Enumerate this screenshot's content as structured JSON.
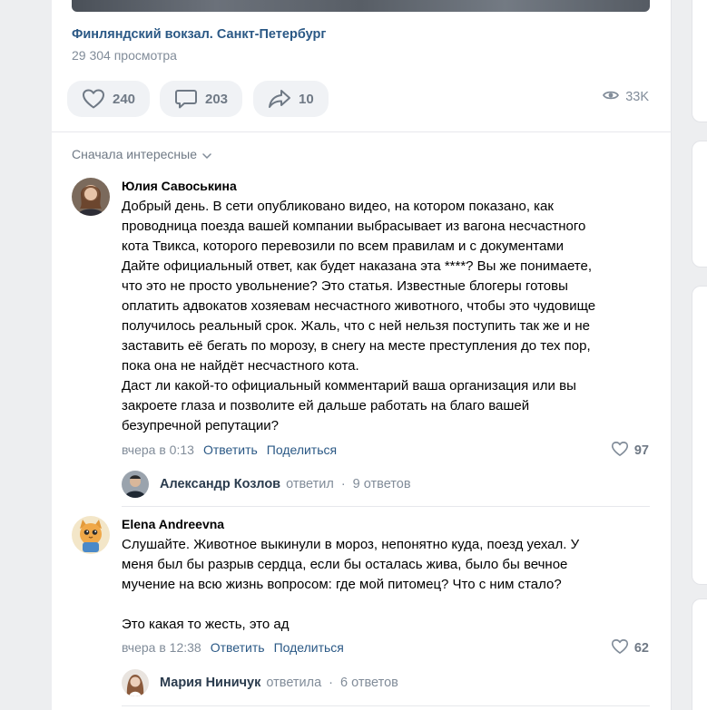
{
  "video": {
    "title": "Финляндский вокзал. Санкт-Петербург",
    "views": "29 304 просмотра"
  },
  "actions": {
    "likes": "240",
    "comments": "203",
    "shares": "10",
    "views_total": "33K"
  },
  "sort": {
    "label": "Сначала интересные"
  },
  "comments": [
    {
      "author": "Юлия Савоськина",
      "text": "Добрый день. В сети опубликовано видео, на котором показано, как\nпроводница поезда вашей компании выбрасывает из вагона несчастного\nкота Твикса, которого перевозили по всем правилам и с документами\nДайте официальный ответ, как будет наказана эта ****? Вы же понимаете,\nчто это не просто увольнение? Это статья. Известные блогеры готовы\nоплатить адвокатов хозяевам несчастного животного, чтобы это чудовище\nполучилось реальный срок. Жаль, что с ней нельзя поступить так же и не\nзаставить её бегать по морозу, в снегу на месте преступления до тех пор,\nпока она не найдёт несчастного кота.\nДаст ли какой-то официальный комментарий ваша организация или вы\nзакроете глаза и позволите ей дальше работать на благо вашей\nбезупречной репутации?",
      "time": "вчера в 0:13",
      "reply_label": "Ответить",
      "share_label": "Поделиться",
      "likes": "97",
      "reply_preview": {
        "name": "Александр Козлов",
        "verb": "ответил",
        "count": "9 ответов"
      }
    },
    {
      "author": "Elena Andreevna",
      "text": "Слушайте. Животное выкинули в мороз, непонятно куда, поезд уехал. У\nменя был бы разрыв сердца, если бы осталась жива, было бы вечное\nмучение на всю жизнь вопросом: где мой питомец? Что с ним стало?\n\nЭто какая то жесть, это ад",
      "time": "вчера в 12:38",
      "reply_label": "Ответить",
      "share_label": "Поделиться",
      "likes": "62",
      "reply_preview": {
        "name": "Мария Ниничук",
        "verb": "ответила",
        "count": "6 ответов"
      }
    }
  ],
  "colors": {
    "link": "#2a5885",
    "secondary": "#818c99",
    "button_bg": "#f0f2f5",
    "page_bg": "#edeef0"
  },
  "icons": [
    "heart-icon",
    "comment-icon",
    "share-icon",
    "eye-icon",
    "chevron-down-icon"
  ]
}
